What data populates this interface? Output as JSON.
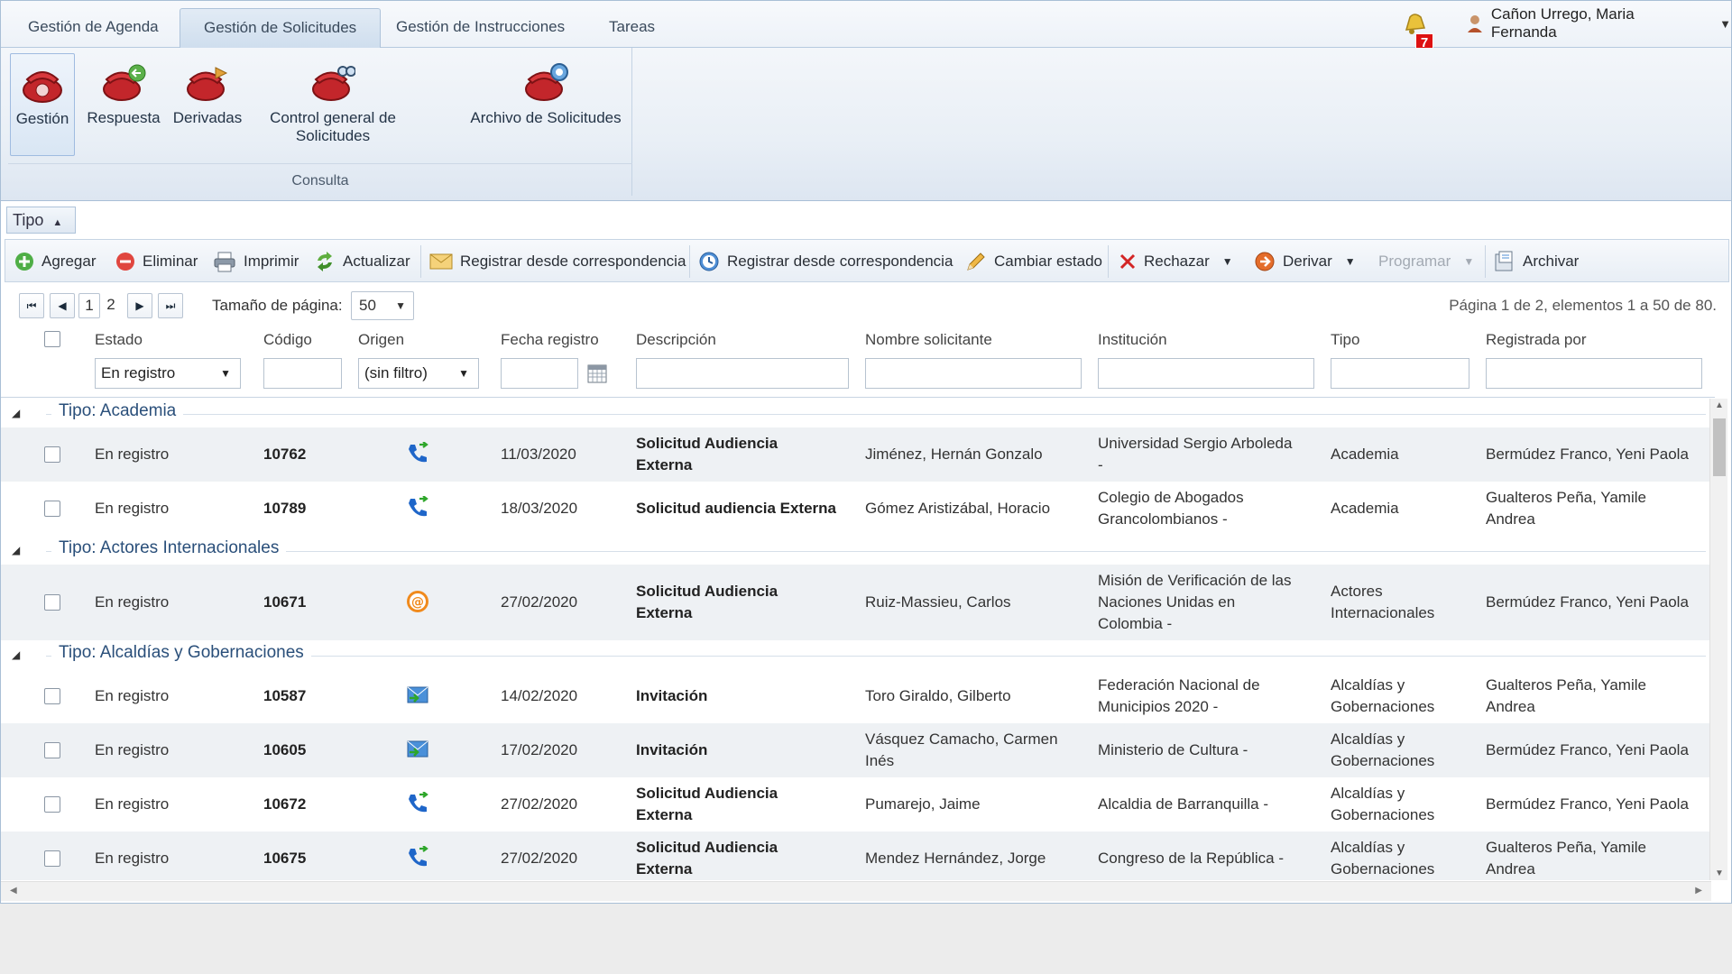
{
  "top_tabs": [
    "Gestión de Agenda",
    "Gestión de Solicitudes",
    "Gestión de Instrucciones",
    "Tareas"
  ],
  "notifications_count": "7",
  "user_name": "Cañon Urrego, Maria Fernanda",
  "ribbon": {
    "buttons": [
      "Gestión",
      "Respuesta",
      "Derivadas",
      "Control general de Solicitudes",
      "Archivo de Solicitudes"
    ],
    "group_caption": "Consulta"
  },
  "group_by_label": "Tipo",
  "toolbar": {
    "agregar": "Agregar",
    "eliminar": "Eliminar",
    "imprimir": "Imprimir",
    "actualizar": "Actualizar",
    "registrar_corr_1": "Registrar desde correspondencia",
    "registrar_corr_2": "Registrar desde correspondencia",
    "cambiar_estado": "Cambiar estado",
    "rechazar": "Rechazar",
    "derivar": "Derivar",
    "programar": "Programar",
    "archivar": "Archivar"
  },
  "pager": {
    "pages": [
      "1",
      "2"
    ],
    "page_size_label": "Tamaño de página:",
    "page_size": "50",
    "info": "Página 1 de 2, elementos 1 a 50 de 80."
  },
  "columns": [
    "Estado",
    "Código",
    "Origen",
    "Fecha registro",
    "Descripción",
    "Nombre solicitante",
    "Institución",
    "Tipo",
    "Registrada por"
  ],
  "filters": {
    "estado": "En registro",
    "origen": "(sin filtro)"
  },
  "groups": [
    {
      "title": "Tipo: Academia",
      "rows": [
        {
          "estado": "En registro",
          "codigo": "10762",
          "origen": "phone",
          "fecha": "11/03/2020",
          "descripcion": [
            "Solicitud Audiencia",
            "Externa"
          ],
          "solicitante": [
            "Jiménez, Hernán Gonzalo"
          ],
          "institucion": [
            "Universidad Sergio Arboleda",
            "-"
          ],
          "tipo": [
            "Academia"
          ],
          "registrada": [
            "Bermúdez Franco, Yeni Paola"
          ]
        },
        {
          "estado": "En registro",
          "codigo": "10789",
          "origen": "phone",
          "fecha": "18/03/2020",
          "descripcion": [
            "Solicitud audiencia Externa"
          ],
          "solicitante": [
            "Gómez Aristizábal, Horacio"
          ],
          "institucion": [
            "Colegio de Abogados",
            "Grancolombianos -"
          ],
          "tipo": [
            "Academia"
          ],
          "registrada": [
            "Gualteros Peña, Yamile",
            "Andrea"
          ]
        }
      ]
    },
    {
      "title": "Tipo: Actores Internacionales",
      "rows": [
        {
          "estado": "En registro",
          "codigo": "10671",
          "origen": "email",
          "fecha": "27/02/2020",
          "descripcion": [
            "Solicitud Audiencia",
            "Externa"
          ],
          "solicitante": [
            "Ruiz-Massieu, Carlos"
          ],
          "institucion": [
            "Misión de Verificación de las",
            "Naciones Unidas en",
            "Colombia -"
          ],
          "tipo": [
            "Actores",
            "Internacionales"
          ],
          "registrada": [
            "Bermúdez Franco, Yeni Paola"
          ]
        }
      ]
    },
    {
      "title": "Tipo: Alcaldías y Gobernaciones",
      "rows": [
        {
          "estado": "En registro",
          "codigo": "10587",
          "origen": "mail",
          "fecha": "14/02/2020",
          "descripcion": [
            "Invitación"
          ],
          "solicitante": [
            "Toro Giraldo, Gilberto"
          ],
          "institucion": [
            "Federación Nacional de",
            "Municipios 2020 -"
          ],
          "tipo": [
            "Alcaldías y",
            "Gobernaciones"
          ],
          "registrada": [
            "Gualteros Peña, Yamile",
            "Andrea"
          ]
        },
        {
          "estado": "En registro",
          "codigo": "10605",
          "origen": "mail",
          "fecha": "17/02/2020",
          "descripcion": [
            "Invitación"
          ],
          "solicitante": [
            "Vásquez Camacho, Carmen",
            "Inés"
          ],
          "institucion": [
            "Ministerio de Cultura -"
          ],
          "tipo": [
            "Alcaldías y",
            "Gobernaciones"
          ],
          "registrada": [
            "Bermúdez Franco, Yeni Paola"
          ]
        },
        {
          "estado": "En registro",
          "codigo": "10672",
          "origen": "phone",
          "fecha": "27/02/2020",
          "descripcion": [
            "Solicitud Audiencia",
            "Externa"
          ],
          "solicitante": [
            "Pumarejo, Jaime"
          ],
          "institucion": [
            "Alcaldia de Barranquilla -"
          ],
          "tipo": [
            "Alcaldías y",
            "Gobernaciones"
          ],
          "registrada": [
            "Bermúdez Franco, Yeni Paola"
          ]
        },
        {
          "estado": "En registro",
          "codigo": "10675",
          "origen": "phone",
          "fecha": "27/02/2020",
          "descripcion": [
            "Solicitud Audiencia",
            "Externa"
          ],
          "solicitante": [
            "Mendez Hernández, Jorge"
          ],
          "institucion": [
            "Congreso de la República -"
          ],
          "tipo": [
            "Alcaldías y",
            "Gobernaciones"
          ],
          "registrada": [
            "Gualteros Peña, Yamile",
            "Andrea"
          ]
        }
      ]
    }
  ],
  "colors": {
    "accent": "#2a4f7a",
    "header_bg": "#e9eff6",
    "row_alt": "#eef1f4",
    "badge": "#dd1111"
  }
}
